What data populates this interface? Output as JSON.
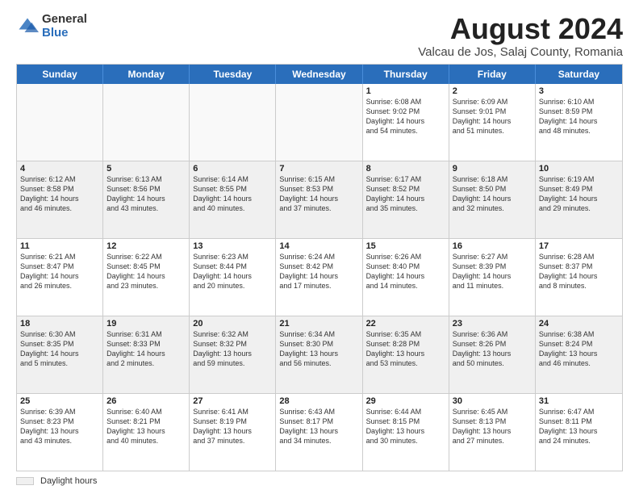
{
  "logo": {
    "general": "General",
    "blue": "Blue"
  },
  "title": "August 2024",
  "subtitle": "Valcau de Jos, Salaj County, Romania",
  "days": [
    "Sunday",
    "Monday",
    "Tuesday",
    "Wednesday",
    "Thursday",
    "Friday",
    "Saturday"
  ],
  "weeks": [
    [
      {
        "date": "",
        "info": ""
      },
      {
        "date": "",
        "info": ""
      },
      {
        "date": "",
        "info": ""
      },
      {
        "date": "",
        "info": ""
      },
      {
        "date": "1",
        "info": "Sunrise: 6:08 AM\nSunset: 9:02 PM\nDaylight: 14 hours\nand 54 minutes."
      },
      {
        "date": "2",
        "info": "Sunrise: 6:09 AM\nSunset: 9:01 PM\nDaylight: 14 hours\nand 51 minutes."
      },
      {
        "date": "3",
        "info": "Sunrise: 6:10 AM\nSunset: 8:59 PM\nDaylight: 14 hours\nand 48 minutes."
      }
    ],
    [
      {
        "date": "4",
        "info": "Sunrise: 6:12 AM\nSunset: 8:58 PM\nDaylight: 14 hours\nand 46 minutes."
      },
      {
        "date": "5",
        "info": "Sunrise: 6:13 AM\nSunset: 8:56 PM\nDaylight: 14 hours\nand 43 minutes."
      },
      {
        "date": "6",
        "info": "Sunrise: 6:14 AM\nSunset: 8:55 PM\nDaylight: 14 hours\nand 40 minutes."
      },
      {
        "date": "7",
        "info": "Sunrise: 6:15 AM\nSunset: 8:53 PM\nDaylight: 14 hours\nand 37 minutes."
      },
      {
        "date": "8",
        "info": "Sunrise: 6:17 AM\nSunset: 8:52 PM\nDaylight: 14 hours\nand 35 minutes."
      },
      {
        "date": "9",
        "info": "Sunrise: 6:18 AM\nSunset: 8:50 PM\nDaylight: 14 hours\nand 32 minutes."
      },
      {
        "date": "10",
        "info": "Sunrise: 6:19 AM\nSunset: 8:49 PM\nDaylight: 14 hours\nand 29 minutes."
      }
    ],
    [
      {
        "date": "11",
        "info": "Sunrise: 6:21 AM\nSunset: 8:47 PM\nDaylight: 14 hours\nand 26 minutes."
      },
      {
        "date": "12",
        "info": "Sunrise: 6:22 AM\nSunset: 8:45 PM\nDaylight: 14 hours\nand 23 minutes."
      },
      {
        "date": "13",
        "info": "Sunrise: 6:23 AM\nSunset: 8:44 PM\nDaylight: 14 hours\nand 20 minutes."
      },
      {
        "date": "14",
        "info": "Sunrise: 6:24 AM\nSunset: 8:42 PM\nDaylight: 14 hours\nand 17 minutes."
      },
      {
        "date": "15",
        "info": "Sunrise: 6:26 AM\nSunset: 8:40 PM\nDaylight: 14 hours\nand 14 minutes."
      },
      {
        "date": "16",
        "info": "Sunrise: 6:27 AM\nSunset: 8:39 PM\nDaylight: 14 hours\nand 11 minutes."
      },
      {
        "date": "17",
        "info": "Sunrise: 6:28 AM\nSunset: 8:37 PM\nDaylight: 14 hours\nand 8 minutes."
      }
    ],
    [
      {
        "date": "18",
        "info": "Sunrise: 6:30 AM\nSunset: 8:35 PM\nDaylight: 14 hours\nand 5 minutes."
      },
      {
        "date": "19",
        "info": "Sunrise: 6:31 AM\nSunset: 8:33 PM\nDaylight: 14 hours\nand 2 minutes."
      },
      {
        "date": "20",
        "info": "Sunrise: 6:32 AM\nSunset: 8:32 PM\nDaylight: 13 hours\nand 59 minutes."
      },
      {
        "date": "21",
        "info": "Sunrise: 6:34 AM\nSunset: 8:30 PM\nDaylight: 13 hours\nand 56 minutes."
      },
      {
        "date": "22",
        "info": "Sunrise: 6:35 AM\nSunset: 8:28 PM\nDaylight: 13 hours\nand 53 minutes."
      },
      {
        "date": "23",
        "info": "Sunrise: 6:36 AM\nSunset: 8:26 PM\nDaylight: 13 hours\nand 50 minutes."
      },
      {
        "date": "24",
        "info": "Sunrise: 6:38 AM\nSunset: 8:24 PM\nDaylight: 13 hours\nand 46 minutes."
      }
    ],
    [
      {
        "date": "25",
        "info": "Sunrise: 6:39 AM\nSunset: 8:23 PM\nDaylight: 13 hours\nand 43 minutes."
      },
      {
        "date": "26",
        "info": "Sunrise: 6:40 AM\nSunset: 8:21 PM\nDaylight: 13 hours\nand 40 minutes."
      },
      {
        "date": "27",
        "info": "Sunrise: 6:41 AM\nSunset: 8:19 PM\nDaylight: 13 hours\nand 37 minutes."
      },
      {
        "date": "28",
        "info": "Sunrise: 6:43 AM\nSunset: 8:17 PM\nDaylight: 13 hours\nand 34 minutes."
      },
      {
        "date": "29",
        "info": "Sunrise: 6:44 AM\nSunset: 8:15 PM\nDaylight: 13 hours\nand 30 minutes."
      },
      {
        "date": "30",
        "info": "Sunrise: 6:45 AM\nSunset: 8:13 PM\nDaylight: 13 hours\nand 27 minutes."
      },
      {
        "date": "31",
        "info": "Sunrise: 6:47 AM\nSunset: 8:11 PM\nDaylight: 13 hours\nand 24 minutes."
      }
    ]
  ],
  "footer": {
    "legend_label": "Daylight hours"
  }
}
